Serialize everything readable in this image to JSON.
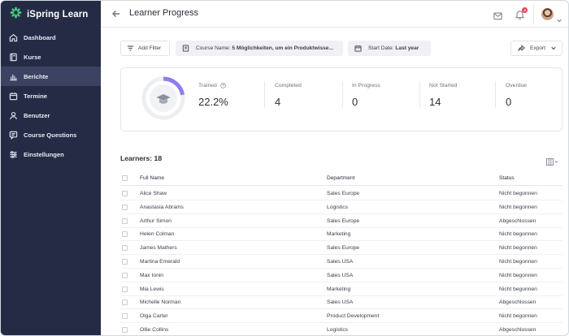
{
  "app": {
    "name": "iSpring Learn",
    "brand_color": "#3ecf7a",
    "sidebar_bg": "#262b45"
  },
  "sidebar": {
    "items": [
      {
        "label": "Dashboard",
        "icon": "home-icon"
      },
      {
        "label": "Kurse",
        "icon": "book-icon"
      },
      {
        "label": "Berichte",
        "icon": "bar-chart-icon",
        "active": true
      },
      {
        "label": "Termine",
        "icon": "calendar-icon"
      },
      {
        "label": "Benutzer",
        "icon": "users-icon"
      },
      {
        "label": "Course Questions",
        "icon": "chat-icon"
      },
      {
        "label": "Einstellungen",
        "icon": "sliders-icon"
      }
    ]
  },
  "header": {
    "title": "Learner Progress",
    "notification_count": "4"
  },
  "filters": {
    "add_filter": "Add Filter",
    "course_label": "Course Name:",
    "course_value": "5 Möglichkeiten, um ein Produktwisse...",
    "date_label": "Start Date:",
    "date_value": "Last year",
    "export": "Export"
  },
  "stats": {
    "trained_label": "Trained",
    "trained_value": "22.2%",
    "trained_fraction": 0.222,
    "completed_label": "Completed",
    "completed_value": "4",
    "in_progress_label": "In Progress",
    "in_progress_value": "0",
    "not_started_label": "Not Started",
    "not_started_value": "14",
    "overdue_label": "Overdue",
    "overdue_value": "0"
  },
  "table": {
    "learners_count": "Learners: 18",
    "headers": {
      "name": "Full Name",
      "department": "Department",
      "status": "Status"
    },
    "rows": [
      {
        "name": "Alice Shaw",
        "department": "Sales Europe",
        "status": "Nicht begonnen"
      },
      {
        "name": "Anastasia Abrams",
        "department": "Logistics",
        "status": "Nicht begonnen"
      },
      {
        "name": "Arthur Simon",
        "department": "Sales Europe",
        "status": "Abgeschlossen"
      },
      {
        "name": "Helen Colman",
        "department": "Marketing",
        "status": "Nicht begonnen"
      },
      {
        "name": "James Mathers",
        "department": "Sales Europe",
        "status": "Nicht begonnen"
      },
      {
        "name": "Martina Emerald",
        "department": "Sales USA",
        "status": "Nicht begonnen"
      },
      {
        "name": "Max Ionin",
        "department": "Sales USA",
        "status": "Nicht begonnen"
      },
      {
        "name": "Mia Lewis",
        "department": "Marketing",
        "status": "Nicht begonnen"
      },
      {
        "name": "Michelle Norman",
        "department": "Sales USA",
        "status": "Abgeschlossen"
      },
      {
        "name": "Olga Carter",
        "department": "Product Development",
        "status": "Nicht begonnen"
      },
      {
        "name": "Ollie Collins",
        "department": "Logistics",
        "status": "Abgeschlossen"
      }
    ]
  }
}
